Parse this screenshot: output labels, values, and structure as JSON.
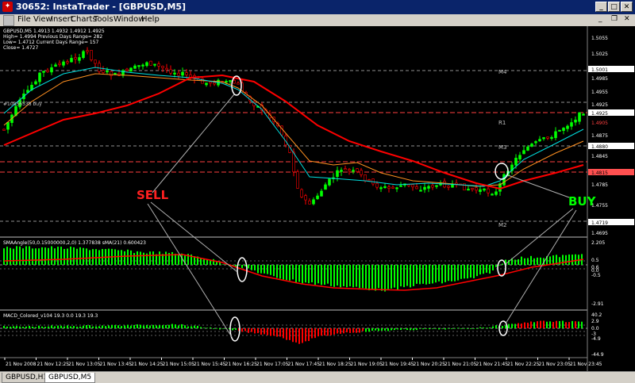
{
  "window": {
    "title": "30652: InstaTrader - [GBPUSD,M5]",
    "icon": "app-icon"
  },
  "menu": [
    "File",
    "View",
    "Insert",
    "Charts",
    "Tools",
    "Window",
    "Help"
  ],
  "info": {
    "line1": "GBPUSD,M5  1.4913 1.4932 1.4912 1.4925",
    "line2": "High= 1.4994    Previous Days Range= 282",
    "line3": "Low= 1.4712     Current Days Range= 157",
    "line4": "Close= 1.4727",
    "order": "#10856538 buy"
  },
  "price_axis": [
    "1.5055",
    "1.5025",
    "1.5001",
    "1.4985",
    "1.4955",
    "1.4925",
    "1.4925",
    "1.4905",
    "1.4880",
    "1.4875",
    "1.4845",
    "1.4815",
    "1.4785",
    "1.4755",
    "1.4719",
    "1.4695"
  ],
  "pivot_labels": [
    "M4",
    "R1",
    "M3",
    "M2"
  ],
  "sma_label": "SMAAngle(50,0.15000000,2,0) 1.377838  sMA(21) 0.600423",
  "sma_axis": [
    "2.205",
    "0.5",
    "0.6",
    "0.0",
    "-0.5",
    "-2.91"
  ],
  "macd_label": "MACD_Colored_v104 19.3 0.0 19.3 19.3",
  "macd_axis": [
    "40.2",
    "2.9",
    "0.0",
    "-3",
    "-4.9",
    "-44.9"
  ],
  "time_axis": [
    "21 Nov 2008",
    "21 Nov 12:25",
    "21 Nov 13:05",
    "21 Nov 13:45",
    "21 Nov 14:25",
    "21 Nov 15:05",
    "21 Nov 15:45",
    "21 Nov 16:25",
    "21 Nov 17:05",
    "21 Nov 17:45",
    "21 Nov 18:25",
    "21 Nov 19:05",
    "21 Nov 19:45",
    "21 Nov 20:25",
    "21 Nov 21:05",
    "21 Nov 21:45",
    "21 Nov 22:25",
    "21 Nov 23:05",
    "21 Nov 23:45"
  ],
  "annotations": {
    "sell": "SELL",
    "buy": "BUY"
  },
  "tabs": [
    "GBPUSD,H1",
    "GBPUSD,M5"
  ],
  "colors": {
    "bull": "#00ff00",
    "bear": "#ff0000",
    "ma_red": "#ff0000",
    "ma_cyan": "#00e0e0",
    "ma_orange": "#ff9020",
    "sell": "#ff2020",
    "buy": "#00ff00"
  }
}
